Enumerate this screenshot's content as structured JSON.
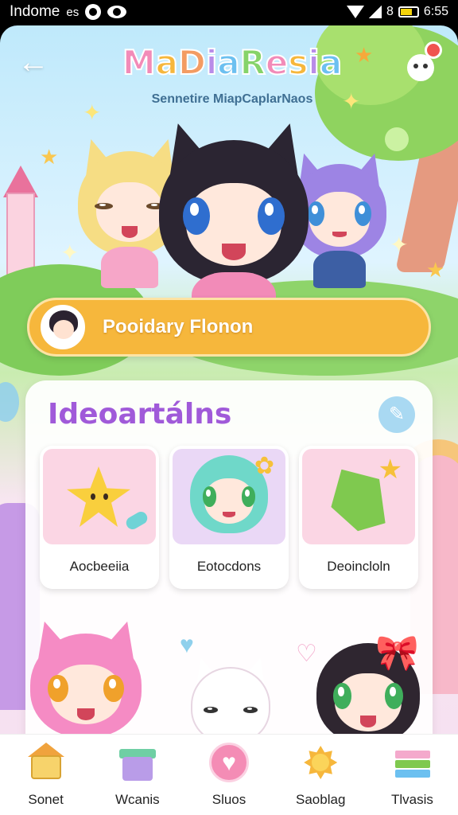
{
  "status_bar": {
    "left_text": "Indome",
    "carrier": "es",
    "battery_symbol": "8",
    "time": "6:55"
  },
  "header": {
    "back_icon": "arrow-left-icon",
    "logo_text": "MaDiaResia",
    "logo_colors": [
      "#f28bb8",
      "#f6b73c",
      "#f39c63",
      "#b98ce8",
      "#6cc0f0",
      "#86d36a",
      "#f28bb8",
      "#f6b73c",
      "#b98ce8",
      "#6cc0f0"
    ],
    "subtitle": "Sennetire MiapCaplarNaos"
  },
  "featured": {
    "label": "Pooidary Flonon"
  },
  "section": {
    "title": "Ideoartálns",
    "edit_icon": "pencil-icon",
    "tiles": [
      {
        "name": "Aocbeeiia"
      },
      {
        "name": "Eotocdons"
      },
      {
        "name": "Deoincloln"
      }
    ]
  },
  "navbar": {
    "items": [
      {
        "label": "Sonet",
        "icon": "house-icon"
      },
      {
        "label": "Wcanis",
        "icon": "gift-box-icon"
      },
      {
        "label": "Sluos",
        "icon": "heart-icon"
      },
      {
        "label": "Saoblag",
        "icon": "sun-icon"
      },
      {
        "label": "Tlvasis",
        "icon": "books-icon"
      }
    ]
  },
  "colors": {
    "accent_orange": "#f6b73c",
    "title_purple": "#a05ad9",
    "sky": "#bfe9fb"
  }
}
